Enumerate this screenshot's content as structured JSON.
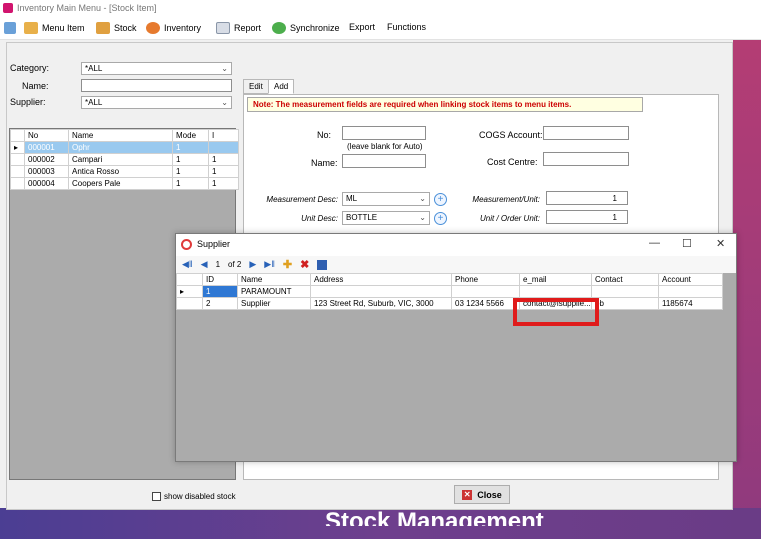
{
  "window": {
    "title": "Inventory Main Menu - [Stock Item]"
  },
  "toolbar": {
    "menu_item": "Menu Item",
    "stock": "Stock",
    "inventory": "Inventory",
    "report": "Report",
    "synchronize": "Synchronize",
    "export": "Export",
    "functions": "Functions"
  },
  "filters": {
    "category_label": "Category:",
    "category_value": "*ALL",
    "name_label": "Name:",
    "name_value": "",
    "supplier_label": "Supplier:",
    "supplier_value": "*ALL"
  },
  "stock_grid": {
    "headers": [
      "No",
      "Name",
      "Mode",
      "I"
    ],
    "rows": [
      [
        "000001",
        "Ophr",
        "1",
        ""
      ],
      [
        "000002",
        "Campari",
        "1",
        "1"
      ],
      [
        "000003",
        "Antica Rosso",
        "1",
        "1"
      ],
      [
        "000004",
        "Coopers Pale",
        "1",
        "1"
      ]
    ]
  },
  "tabs": {
    "edit": "Edit",
    "add": "Add"
  },
  "form": {
    "note": "Note: The measurement fields are required when linking stock items to menu items.",
    "no_label": "No:",
    "no_hint": "(leave blank for Auto)",
    "name_label": "Name:",
    "cogs_label": "COGS Account:",
    "cost_centre_label": "Cost Centre:",
    "meas_desc_label": "Measurement Desc:",
    "meas_desc_value": "ML",
    "meas_unit_label": "Measurement/Unit:",
    "meas_unit_value": "1",
    "unit_desc_label": "Unit Desc:",
    "unit_desc_value": "BOTTLE",
    "unit_order_label": "Unit / Order Unit:",
    "unit_order_value": "1"
  },
  "show_disabled": "show disabled stock",
  "close_button": "Close",
  "banner_text": "Stock Management",
  "supplier_window": {
    "title": "Supplier",
    "nav_position": "1",
    "nav_total": "of 2",
    "headers": [
      "ID",
      "Name",
      "Address",
      "Phone",
      "e_mail",
      "Contact",
      "Account"
    ],
    "rows": [
      [
        "1",
        "PARAMOUNT",
        "",
        "",
        "",
        "",
        ""
      ],
      [
        "2",
        "Supplier",
        "123 Street Rd, Suburb, VIC, 3000",
        "03 1234 5566",
        "contact@isupplie...",
        "bb",
        "1185674"
      ]
    ]
  },
  "colors": {
    "accent": "#d1146e",
    "highlight": "#e01b1b",
    "selection": "#99c9ef"
  }
}
